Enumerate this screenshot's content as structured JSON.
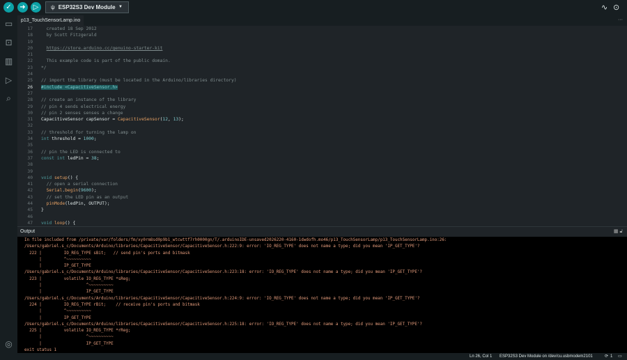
{
  "toolbar": {
    "verify_icon": "check-icon",
    "upload_icon": "arrow-right-icon",
    "debug_icon": "debug-icon",
    "board": "ESP32S3 Dev Module",
    "board_icon": "usb-icon",
    "serial_plotter_icon": "plotter-icon",
    "serial_monitor_icon": "monitor-icon"
  },
  "sidebar": {
    "items": [
      "folder-icon",
      "board-manager-icon",
      "library-icon",
      "debug-icon",
      "search-icon"
    ],
    "account_icon": "user-icon"
  },
  "tab": {
    "filename": "p13_TouchSensorLamp.ino",
    "more": "···"
  },
  "code": {
    "current_line": 26,
    "lines": [
      [
        17,
        [
          [
            "  created 18 Sep 2012",
            "c"
          ]
        ]
      ],
      [
        18,
        [
          [
            "  by Scott Fitzgerald",
            "c"
          ]
        ]
      ],
      [
        19,
        []
      ],
      [
        20,
        [
          [
            "  ",
            "c"
          ],
          [
            "https://store.arduino.cc/genuino-starter-kit",
            "u"
          ]
        ]
      ],
      [
        21,
        []
      ],
      [
        22,
        [
          [
            "  This example code is part of the public domain.",
            "c"
          ]
        ]
      ],
      [
        23,
        [
          [
            "*/",
            "c"
          ]
        ]
      ],
      [
        24,
        []
      ],
      [
        25,
        [
          [
            "// import the library (must be located in the Arduino/libraries directory)",
            "c"
          ]
        ]
      ],
      [
        26,
        [
          [
            "#include <CapacitiveSensor.h>",
            "h"
          ]
        ]
      ],
      [
        27,
        []
      ],
      [
        28,
        [
          [
            "// create an instance of the library",
            "c"
          ]
        ]
      ],
      [
        29,
        [
          [
            "// pin 4 sends electrical energy",
            "c"
          ]
        ]
      ],
      [
        30,
        [
          [
            "// pin 2 senses senses a change",
            "c"
          ]
        ]
      ],
      [
        31,
        [
          [
            "CapacitiveSensor capSensor = ",
            "t"
          ],
          [
            "CapacitiveSensor",
            "f"
          ],
          [
            "(",
            "t"
          ],
          [
            "12",
            "n"
          ],
          [
            ", ",
            "t"
          ],
          [
            "13",
            "n"
          ],
          [
            ");",
            "t"
          ]
        ]
      ],
      [
        32,
        []
      ],
      [
        33,
        [
          [
            "// threshold for turning the lamp on",
            "c"
          ]
        ]
      ],
      [
        34,
        [
          [
            "int",
            "k"
          ],
          [
            " threshold = ",
            "t"
          ],
          [
            "1000",
            "n"
          ],
          [
            ";",
            "t"
          ]
        ]
      ],
      [
        35,
        []
      ],
      [
        36,
        [
          [
            "// pin the LED is connected to",
            "c"
          ]
        ]
      ],
      [
        37,
        [
          [
            "const int",
            "k"
          ],
          [
            " ledPin = ",
            "t"
          ],
          [
            "38",
            "n"
          ],
          [
            ";",
            "t"
          ]
        ]
      ],
      [
        38,
        []
      ],
      [
        39,
        []
      ],
      [
        40,
        [
          [
            "void",
            "k"
          ],
          [
            " ",
            "t"
          ],
          [
            "setup",
            "f"
          ],
          [
            "() {",
            "t"
          ]
        ]
      ],
      [
        41,
        [
          [
            "  // open a serial connection",
            "c"
          ]
        ]
      ],
      [
        42,
        [
          [
            "  ",
            "t"
          ],
          [
            "Serial",
            "f"
          ],
          [
            ".",
            "t"
          ],
          [
            "begin",
            "f"
          ],
          [
            "(",
            "t"
          ],
          [
            "9600",
            "n"
          ],
          [
            ");",
            "t"
          ]
        ]
      ],
      [
        43,
        [
          [
            "  // set the LED pin as an output",
            "c"
          ]
        ]
      ],
      [
        44,
        [
          [
            "  ",
            "t"
          ],
          [
            "pinMode",
            "f"
          ],
          [
            "(ledPin, OUTPUT);",
            "t"
          ]
        ]
      ],
      [
        45,
        [
          [
            "}",
            "t"
          ]
        ]
      ],
      [
        46,
        []
      ],
      [
        47,
        [
          [
            "void",
            "k"
          ],
          [
            " ",
            "t"
          ],
          [
            "loop",
            "f"
          ],
          [
            "() {",
            "t"
          ]
        ]
      ]
    ]
  },
  "output": {
    "title": "Output",
    "icons": [
      "clear-output-icon",
      "lock-icon"
    ],
    "lines": [
      "In file included from /private/var/folders/fm/xy0rm8sd0p9b1_wtcwttf7rh0000gn/T/.arduinoIDE-unsaved2026220-4160-1dwdofh.mo46/p13_TouchSensorLamp/p13_TouchSensorLamp.ino:26:",
      "/Users/gabriel.s_c/Documents/Arduino/libraries/CapacitiveSensor/CapacitiveSensor.h:222:9: error: 'IO_REG_TYPE' does not name a type; did you mean 'IP_GET_TYPE'?",
      "  222 |         IO_REG_TYPE sBit;   // send pin's ports and bitmask",
      "      |         ^~~~~~~~~~~",
      "      |         IP_GET_TYPE",
      "/Users/gabriel.s_c/Documents/Arduino/libraries/CapacitiveSensor/CapacitiveSensor.h:223:18: error: 'IO_REG_TYPE' does not name a type; did you mean 'IP_GET_TYPE'?",
      "  223 |         volatile IO_REG_TYPE *sReg;",
      "      |                  ^~~~~~~~~~~",
      "      |                  IP_GET_TYPE",
      "/Users/gabriel.s_c/Documents/Arduino/libraries/CapacitiveSensor/CapacitiveSensor.h:224:9: error: 'IO_REG_TYPE' does not name a type; did you mean 'IP_GET_TYPE'?",
      "  224 |         IO_REG_TYPE rBit;    // receive pin's ports and bitmask",
      "      |         ^~~~~~~~~~~",
      "      |         IP_GET_TYPE",
      "/Users/gabriel.s_c/Documents/Arduino/libraries/CapacitiveSensor/CapacitiveSensor.h:225:18: error: 'IO_REG_TYPE' does not name a type; did you mean 'IP_GET_TYPE'?",
      "  225 |         volatile IO_REG_TYPE *rReg;",
      "      |                  ^~~~~~~~~~~",
      "      |                  IP_GET_TYPE",
      "exit status 1"
    ]
  },
  "status": {
    "position": "Ln 26, Col 1",
    "board_port": "ESP32S3 Dev Module on /dev/cu.usbmodem2101",
    "notifications": "1",
    "notification_icon": "bell-icon",
    "panel_icon": "panel-toggle-icon"
  }
}
